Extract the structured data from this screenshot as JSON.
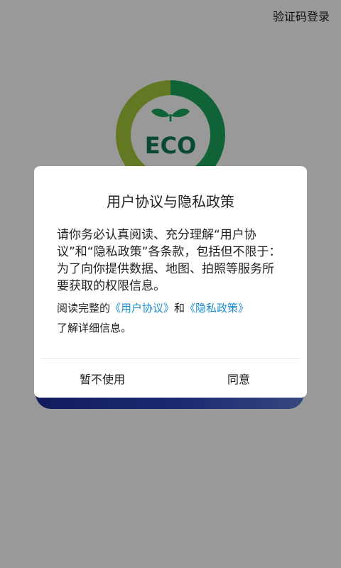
{
  "header": {
    "sms_login_label": "验证码登录"
  },
  "logo": {
    "text": "ECO"
  },
  "dialog": {
    "title": "用户协议与隐私政策",
    "body": "请你务必认真阅读、充分理解“用户协议”和“隐私政策”各条款，包括但不限于：为了向你提供数据、地图、拍照等服务所要获取的权限信息。",
    "links_prefix": "阅读完整的",
    "user_agreement_link": "《用户协议》",
    "links_and": "和",
    "privacy_policy_link": "《隐私政策》",
    "links_suffix": "了解详细信息。",
    "decline_button": "暂不使用",
    "agree_button": "同意"
  },
  "colors": {
    "link": "#1a8fd0",
    "logo_lime": "#8dc63f",
    "logo_green": "#1aa55a",
    "logo_dark": "#0e7a52",
    "bar_blue": "#1f2f9a"
  }
}
